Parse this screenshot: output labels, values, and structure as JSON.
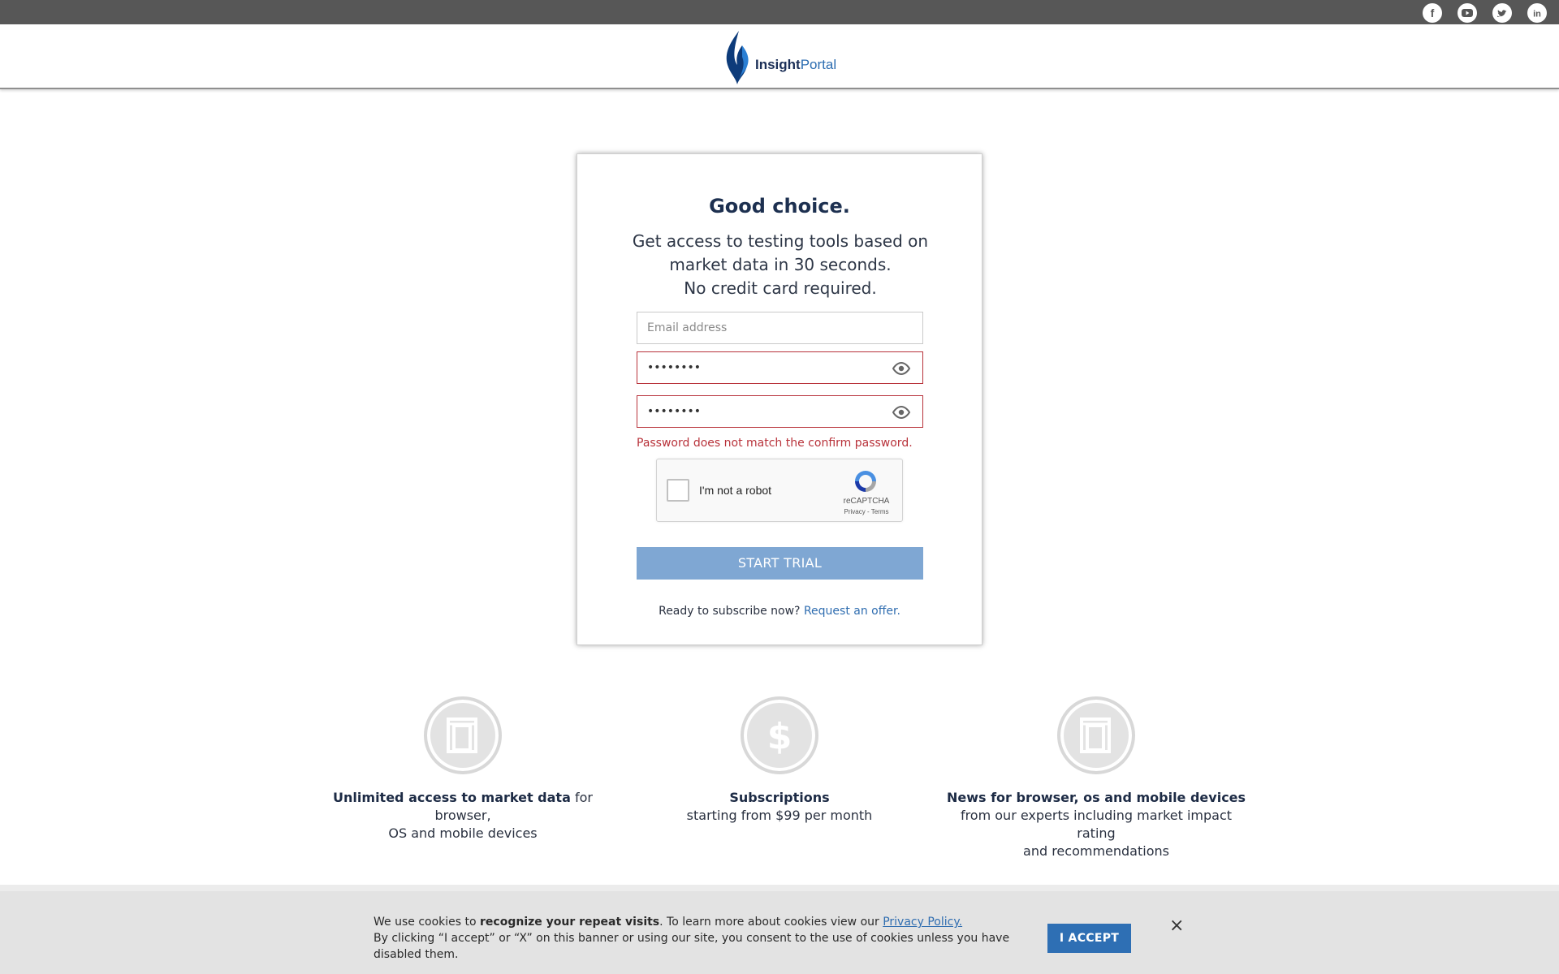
{
  "social": [
    {
      "name": "facebook",
      "glyph": "f"
    },
    {
      "name": "youtube",
      "glyph": "▶"
    },
    {
      "name": "twitter",
      "glyph": "t"
    },
    {
      "name": "linkedin",
      "glyph": "in"
    }
  ],
  "header": {
    "logo_bold": "Insight",
    "logo_light": "Portal",
    "brand_color": "#1b3a6b"
  },
  "card": {
    "title": "Good choice.",
    "subtitle_line1": "Get access to testing tools based on",
    "subtitle_line2": "market data in 30 seconds.",
    "subtitle_line3": "No credit card required.",
    "email_placeholder": "Email address",
    "email_value": "",
    "password_value": "••••••••",
    "confirm_value": "••••••••",
    "error_message": "Password does not match the confirm password.",
    "captcha_label": "I'm not a robot",
    "captcha_brand": "reCAPTCHA",
    "captcha_links": "Privacy - Terms",
    "start_button": "START TRIAL",
    "subscribe_text": "Ready to subscribe now?",
    "subscribe_link": "Request an offer.",
    "error_color": "#b8323a",
    "button_color": "#7fa7d3"
  },
  "features": [
    {
      "icon": "document-icon",
      "bold": "Unlimited access to market data",
      "rest": " for browser,",
      "line2": "OS and mobile devices",
      "line3": ""
    },
    {
      "icon": "dollar-icon",
      "bold": "Subscriptions",
      "rest": "",
      "line2": "starting from $99 per month",
      "line3": ""
    },
    {
      "icon": "document-icon",
      "bold": "News for browser, os and mobile devices",
      "rest": "",
      "line2": "from our experts including market impact rating",
      "line3": "and recommendations"
    }
  ],
  "cookie": {
    "text_prefix": "We use cookies to ",
    "text_bold": "recognize your repeat visits",
    "text_middle": ". To learn more about cookies view our ",
    "policy_link": "Privacy Policy.",
    "text_line2": "By clicking “I accept” or “X” on this banner or using our site, you consent to the use of cookies unless you have disabled them.",
    "accept_button": "I ACCEPT",
    "close_glyph": "×",
    "accent_color": "#2e6fb4"
  }
}
